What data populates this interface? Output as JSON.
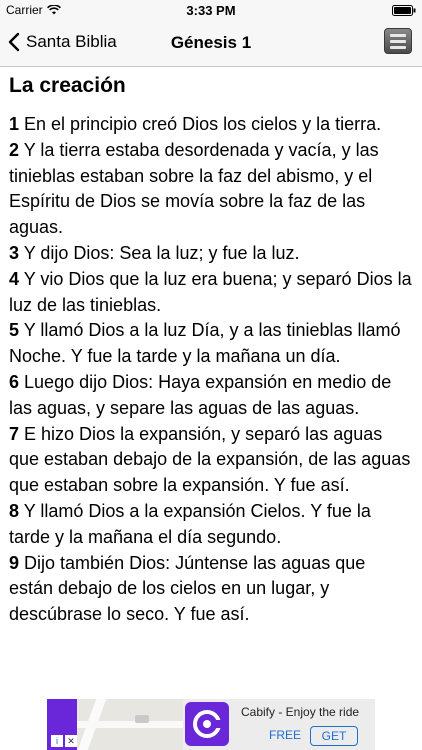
{
  "status_bar": {
    "carrier": "Carrier",
    "time": "3:33 PM"
  },
  "nav": {
    "back_label": "Santa Biblia",
    "title": "Génesis 1"
  },
  "section_title": "La creación",
  "verses": [
    {
      "num": "1",
      "text": "En el principio creó Dios los cielos y la tierra."
    },
    {
      "num": "2",
      "text": "Y la tierra estaba desordenada y vacía, y las tinieblas estaban sobre la faz del abismo, y el Espíritu de Dios se movía sobre la faz de las aguas."
    },
    {
      "num": "3",
      "text": "Y dijo Dios: Sea la luz; y fue la luz."
    },
    {
      "num": "4",
      "text": "Y vio Dios que la luz era buena; y separó Dios la luz de las tinieblas."
    },
    {
      "num": "5",
      "text": "Y llamó Dios a la luz Día, y a las tinieblas llamó Noche. Y fue la tarde y la mañana un día."
    },
    {
      "num": "6",
      "text": "Luego dijo Dios: Haya expansión en medio de las aguas, y separe las aguas de las aguas."
    },
    {
      "num": "7",
      "text": "E hizo Dios la expansión, y separó las aguas que estaban debajo de la expansión, de las aguas que estaban sobre la expansión. Y fue así."
    },
    {
      "num": "8",
      "text": "Y llamó Dios a la expansión Cielos. Y fue la tarde y la mañana el día segundo."
    },
    {
      "num": "9",
      "text": "Dijo también Dios: Júntense las aguas que están debajo de los cielos en un lugar, y descúbrase lo seco. Y fue así."
    }
  ],
  "ad": {
    "title": "Cabify - Enjoy the ride",
    "price": "FREE",
    "cta": "GET",
    "brand_color": "#6a27d9",
    "cta_color": "#1f6fd1"
  }
}
